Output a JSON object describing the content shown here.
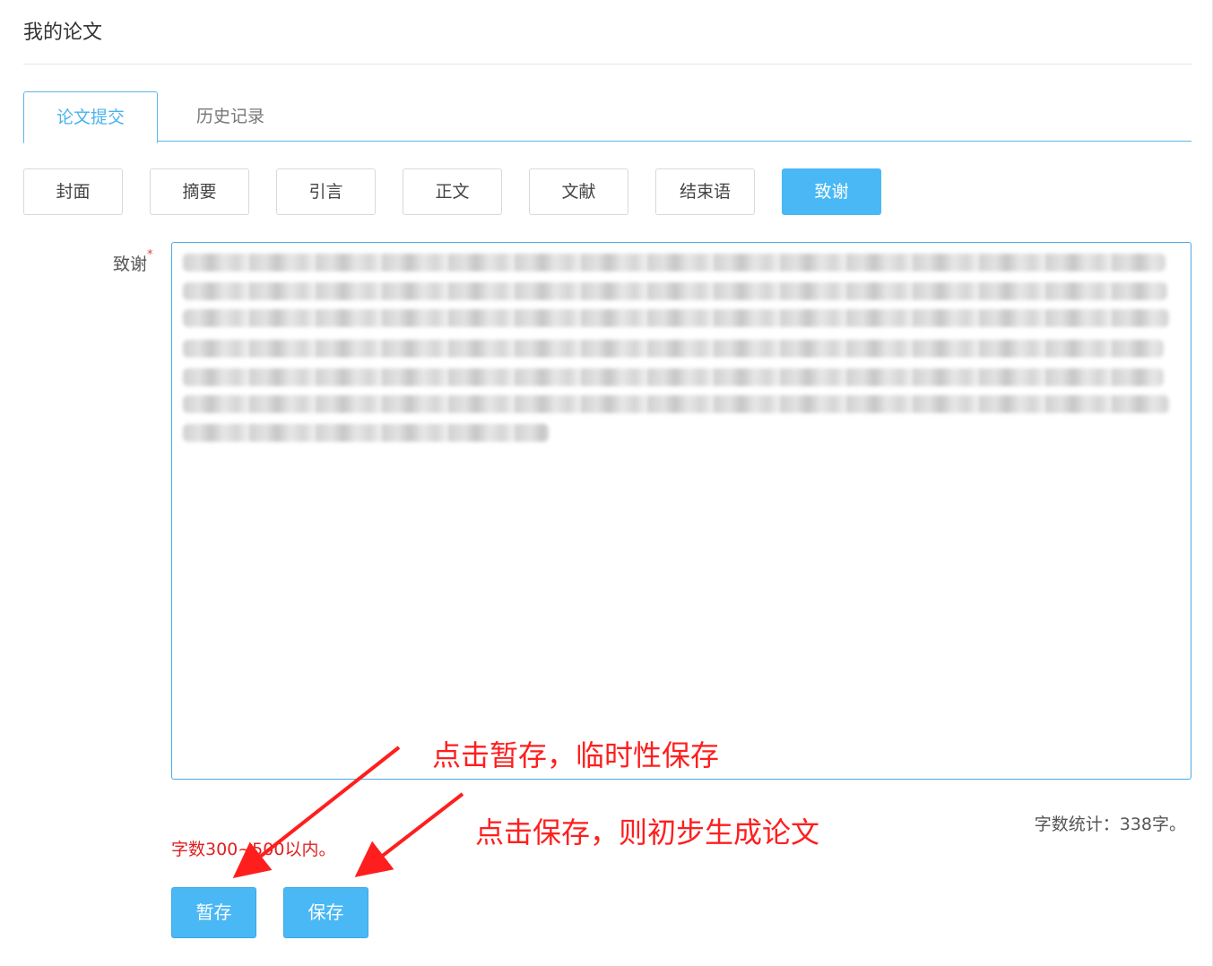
{
  "page": {
    "title": "我的论文"
  },
  "tabs": [
    {
      "label": "论文提交",
      "active": true
    },
    {
      "label": "历史记录",
      "active": false
    }
  ],
  "sections": [
    {
      "label": "封面"
    },
    {
      "label": "摘要"
    },
    {
      "label": "引言"
    },
    {
      "label": "正文"
    },
    {
      "label": "文献"
    },
    {
      "label": "结束语"
    },
    {
      "label": "致谢",
      "active": true
    }
  ],
  "form": {
    "field_label": "致谢",
    "required_mark": "*",
    "word_count": "字数统计：338字。",
    "hint": "字数300~500以内。"
  },
  "actions": {
    "temp_save": "暂存",
    "save": "保存"
  },
  "annotations": {
    "temp_save_note": "点击暂存，临时性保存",
    "save_note": "点击保存，则初步生成论文"
  },
  "colors": {
    "accent": "#4ab8f5",
    "annotation": "#ff1e1e",
    "required": "#e53935"
  }
}
